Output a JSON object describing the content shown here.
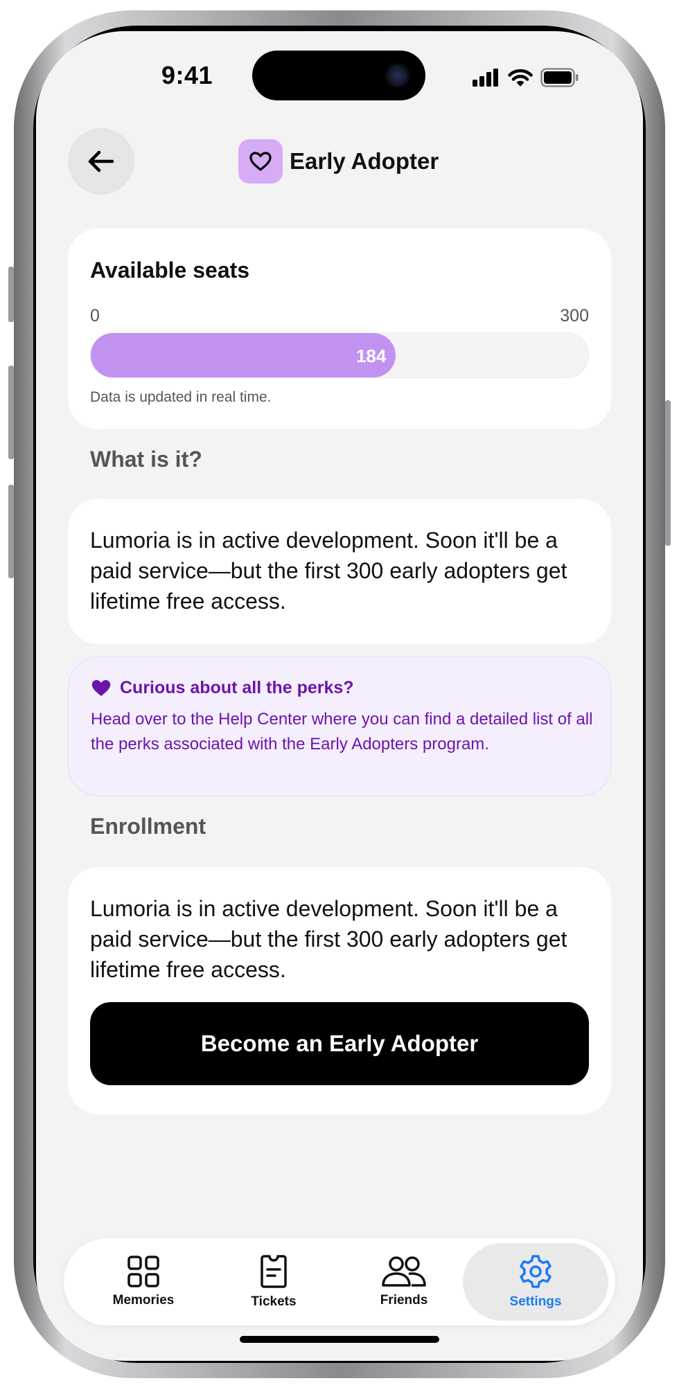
{
  "status_bar": {
    "time": "9:41"
  },
  "header": {
    "title": "Early Adopter",
    "back_icon": "arrow-left-icon",
    "badge_icon": "heart-outline-icon"
  },
  "seats": {
    "title": "Available seats",
    "min_label": "0",
    "max_label": "300",
    "current": "184",
    "current_value": 184,
    "max_value": 300,
    "note": "Data is updated in real time.",
    "bar_color": "#c292f1"
  },
  "what": {
    "label": "What is it?",
    "text": "Lumoria is in active development. Soon it'll be a paid service—but the first 300 early adopters get lifetime free access."
  },
  "perks": {
    "title": "Curious about all the perks?",
    "text": "Head over to the Help Center where you can find a detailed list of all the perks associated with the Early Adopters program.",
    "color": "#6b15ab",
    "icon": "heart-filled-icon"
  },
  "enrollment": {
    "label": "Enrollment",
    "text": "Lumoria is in active development. Soon it'll be a paid service—but the first 300 early adopters get lifetime free access.",
    "button_label": "Become an Early Adopter"
  },
  "tabbar": {
    "tabs": [
      {
        "label": "Memories",
        "icon": "grid-icon",
        "active": false
      },
      {
        "label": "Tickets",
        "icon": "ticket-icon",
        "active": false
      },
      {
        "label": "Friends",
        "icon": "people-icon",
        "active": false
      },
      {
        "label": "Settings",
        "icon": "gear-icon",
        "active": true
      }
    ],
    "active_color": "#1a7cf0"
  }
}
